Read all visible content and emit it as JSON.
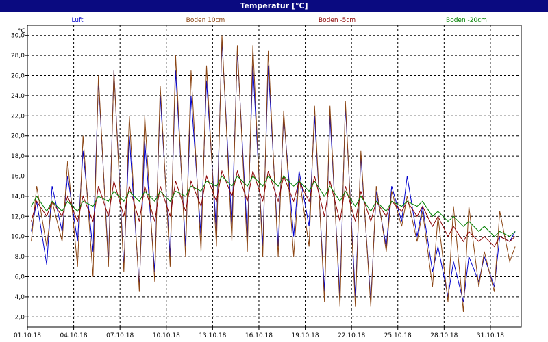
{
  "window": {
    "title": "Temperatur [°C]"
  },
  "chart_data": {
    "type": "line",
    "ylabel": "°C",
    "ylim": [
      1.0,
      31.0
    ],
    "y_ticks": [
      2.0,
      4.0,
      6.0,
      8.0,
      10.0,
      12.0,
      14.0,
      16.0,
      18.0,
      20.0,
      22.0,
      24.0,
      26.0,
      28.0,
      30.0
    ],
    "y_tick_labels": [
      "2,0",
      "4,0",
      "6,0",
      "8,0",
      "10,0",
      "12,0",
      "14,0",
      "16,0",
      "18,0",
      "20,0",
      "22,0",
      "24,0",
      "26,0",
      "28,0",
      "30,0"
    ],
    "x_range": [
      "2018-10-01",
      "2018-11-02"
    ],
    "x_ticks": [
      "2018-10-01",
      "2018-10-04",
      "2018-10-07",
      "2018-10-10",
      "2018-10-13",
      "2018-10-16",
      "2018-10-19",
      "2018-10-22",
      "2018-10-25",
      "2018-10-28",
      "2018-10-31"
    ],
    "x_tick_labels": [
      "01.10.18",
      "04.10.18",
      "07.10.18",
      "10.10.18",
      "13.10.18",
      "16.10.18",
      "19.10.18",
      "22.10.18",
      "25.10.18",
      "28.10.18",
      "31.10.18"
    ],
    "grid": true,
    "legend_position": "top",
    "series": [
      {
        "name": "Luft",
        "color": "#0000cc",
        "x": [
          "2018-10-01",
          "2018-10-02",
          "2018-10-03",
          "2018-10-04",
          "2018-10-05",
          "2018-10-06",
          "2018-10-07",
          "2018-10-08",
          "2018-10-09",
          "2018-10-10",
          "2018-10-11",
          "2018-10-12",
          "2018-10-13",
          "2018-10-14",
          "2018-10-15",
          "2018-10-16",
          "2018-10-17",
          "2018-10-18",
          "2018-10-19",
          "2018-10-20",
          "2018-10-21",
          "2018-10-22",
          "2018-10-23",
          "2018-10-24",
          "2018-10-25",
          "2018-10-26",
          "2018-10-27",
          "2018-10-28",
          "2018-10-29",
          "2018-10-30",
          "2018-10-31",
          "2018-11-01"
        ],
        "min": [
          10.5,
          7.2,
          10.5,
          9.5,
          8.5,
          7.5,
          7.0,
          5.0,
          6.5,
          8.0,
          9.0,
          10.0,
          10.5,
          11.0,
          10.0,
          9.0,
          9.0,
          10.0,
          11.0,
          4.5,
          4.0,
          4.0,
          3.5,
          9.0,
          11.5,
          10.0,
          6.5,
          4.0,
          3.5,
          5.5,
          5.0,
          9.5
        ],
        "max": [
          13.5,
          15.0,
          16.0,
          18.5,
          25.5,
          26.5,
          20.0,
          19.5,
          24.0,
          26.5,
          24.0,
          25.5,
          29.5,
          28.5,
          27.0,
          27.0,
          22.0,
          16.5,
          22.0,
          22.0,
          23.0,
          18.0,
          14.5,
          15.0,
          16.0,
          13.0,
          9.0,
          7.5,
          8.0,
          8.0,
          10.0,
          10.5
        ]
      },
      {
        "name": "Boden 10cm",
        "color": "#8b4513",
        "x": [
          "2018-10-01",
          "2018-10-02",
          "2018-10-03",
          "2018-10-04",
          "2018-10-05",
          "2018-10-06",
          "2018-10-07",
          "2018-10-08",
          "2018-10-09",
          "2018-10-10",
          "2018-10-11",
          "2018-10-12",
          "2018-10-13",
          "2018-10-14",
          "2018-10-15",
          "2018-10-16",
          "2018-10-17",
          "2018-10-18",
          "2018-10-19",
          "2018-10-20",
          "2018-10-21",
          "2018-10-22",
          "2018-10-23",
          "2018-10-24",
          "2018-10-25",
          "2018-10-26",
          "2018-10-27",
          "2018-10-28",
          "2018-10-29",
          "2018-10-30",
          "2018-10-31",
          "2018-11-01"
        ],
        "min": [
          9.5,
          9.0,
          9.5,
          7.0,
          6.0,
          7.0,
          6.5,
          4.5,
          5.5,
          7.0,
          8.0,
          8.5,
          9.0,
          9.5,
          8.5,
          8.0,
          8.0,
          8.0,
          9.0,
          3.5,
          3.0,
          3.0,
          3.0,
          8.5,
          11.0,
          9.5,
          5.0,
          3.5,
          2.5,
          5.0,
          4.5,
          7.5
        ],
        "max": [
          15.0,
          13.5,
          17.5,
          20.0,
          26.0,
          26.5,
          22.0,
          22.0,
          25.0,
          28.0,
          26.5,
          27.0,
          30.0,
          29.0,
          29.0,
          28.5,
          22.5,
          16.0,
          23.0,
          23.0,
          23.5,
          18.5,
          15.0,
          14.5,
          14.0,
          12.5,
          12.0,
          13.0,
          13.0,
          8.5,
          12.5,
          9.0
        ]
      },
      {
        "name": "Boden -5cm",
        "color": "#8b0000",
        "x": [
          "2018-10-01",
          "2018-10-02",
          "2018-10-03",
          "2018-10-04",
          "2018-10-05",
          "2018-10-06",
          "2018-10-07",
          "2018-10-08",
          "2018-10-09",
          "2018-10-10",
          "2018-10-11",
          "2018-10-12",
          "2018-10-13",
          "2018-10-14",
          "2018-10-15",
          "2018-10-16",
          "2018-10-17",
          "2018-10-18",
          "2018-10-19",
          "2018-10-20",
          "2018-10-21",
          "2018-10-22",
          "2018-10-23",
          "2018-10-24",
          "2018-10-25",
          "2018-10-26",
          "2018-10-27",
          "2018-10-28",
          "2018-10-29",
          "2018-10-30",
          "2018-10-31",
          "2018-11-01"
        ],
        "min": [
          11.5,
          12.0,
          12.0,
          11.5,
          11.5,
          12.0,
          12.0,
          11.5,
          11.5,
          12.0,
          12.5,
          13.0,
          13.5,
          14.0,
          13.5,
          13.5,
          13.5,
          13.5,
          13.5,
          12.0,
          11.5,
          11.5,
          11.5,
          12.0,
          12.5,
          12.0,
          11.0,
          10.0,
          9.5,
          9.5,
          9.0,
          9.5
        ],
        "max": [
          13.5,
          13.5,
          14.0,
          14.0,
          15.0,
          15.5,
          15.0,
          15.0,
          15.0,
          15.5,
          15.5,
          16.0,
          16.5,
          16.5,
          16.5,
          16.5,
          16.0,
          15.5,
          16.0,
          15.5,
          15.0,
          14.5,
          13.5,
          13.5,
          13.5,
          13.0,
          12.0,
          11.0,
          10.5,
          10.0,
          10.0,
          10.0
        ]
      },
      {
        "name": "Boden -20cm",
        "color": "#008000",
        "x": [
          "2018-10-01",
          "2018-10-02",
          "2018-10-03",
          "2018-10-04",
          "2018-10-05",
          "2018-10-06",
          "2018-10-07",
          "2018-10-08",
          "2018-10-09",
          "2018-10-10",
          "2018-10-11",
          "2018-10-12",
          "2018-10-13",
          "2018-10-14",
          "2018-10-15",
          "2018-10-16",
          "2018-10-17",
          "2018-10-18",
          "2018-10-19",
          "2018-10-20",
          "2018-10-21",
          "2018-10-22",
          "2018-10-23",
          "2018-10-24",
          "2018-10-25",
          "2018-10-26",
          "2018-10-27",
          "2018-10-28",
          "2018-10-29",
          "2018-10-30",
          "2018-10-31",
          "2018-11-01"
        ],
        "min": [
          13.0,
          12.5,
          12.5,
          12.5,
          13.0,
          13.5,
          13.5,
          13.5,
          13.5,
          13.5,
          14.0,
          14.5,
          15.0,
          15.0,
          15.0,
          15.0,
          15.0,
          15.0,
          14.5,
          14.0,
          13.5,
          13.0,
          12.5,
          12.5,
          13.0,
          13.0,
          12.0,
          11.5,
          11.0,
          10.5,
          10.0,
          10.0
        ],
        "max": [
          14.0,
          13.5,
          13.5,
          13.5,
          14.0,
          14.5,
          14.5,
          14.5,
          14.5,
          14.5,
          15.0,
          15.5,
          16.0,
          16.0,
          16.0,
          16.0,
          16.0,
          15.5,
          15.5,
          15.0,
          14.5,
          14.0,
          13.5,
          13.5,
          13.5,
          13.5,
          12.5,
          12.0,
          11.5,
          11.0,
          10.5,
          10.5
        ]
      }
    ]
  }
}
